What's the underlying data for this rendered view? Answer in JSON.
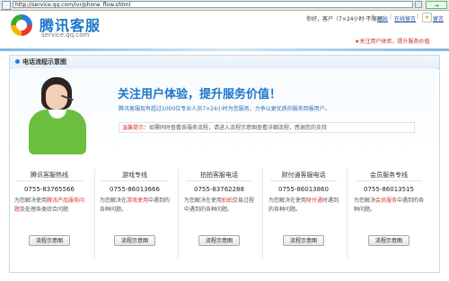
{
  "address_bar": {
    "url": "http://service.qq.com/ivr/phone_flow.shtml",
    "go_label": "→"
  },
  "header": {
    "logo_cn": "腾讯客服",
    "logo_en": "service.qq.com",
    "greeting": "你好，客户（7×24小时·不限时）",
    "links": [
      "退出",
      "在线留言",
      "留言"
    ],
    "slogan": "★关注用户体验，提升服务价值"
  },
  "panel": {
    "title": "电话流程示意图"
  },
  "banner": {
    "title": "关注用户体验，提升服务价值！",
    "subtitle": "腾讯客服现有超过1000位专业人员7×24小时为您服务，力争以更优质的服务回报用户。",
    "note_label": "温馨提示：",
    "note_text": "如需同时查看各服务流程，请进入流程示意图查看详细流程，感谢您的支持"
  },
  "columns": [
    {
      "title": "腾讯客服热线",
      "phone": "0755-83765566",
      "desc_pre": "为您解决使用",
      "desc_hl": "腾讯产品服务问题",
      "desc_post": "及处理各类综合问题",
      "button": "流程示意图"
    },
    {
      "title": "游戏专线",
      "phone": "0755-86013666",
      "desc_pre": "为您解决在",
      "desc_hl": "游戏使用",
      "desc_post": "中遇到的各种问题。",
      "button": "流程示意图"
    },
    {
      "title": "拍拍客服电话",
      "phone": "0755-83762288",
      "desc_pre": "为您解决在使用",
      "desc_hl": "拍拍",
      "desc_post": "交易过程中遇到的各种问题。",
      "button": "流程示意图"
    },
    {
      "title": "财付通客服电话",
      "phone": "0755-86013860",
      "desc_pre": "为您解决在使用",
      "desc_hl": "财付通",
      "desc_post": "时遇到的各种问题。",
      "button": "流程示意图"
    },
    {
      "title": "会员服务专线",
      "phone": "0755-86013515",
      "desc_pre": "为您解决",
      "desc_hl": "会员服务",
      "desc_post": "中遇到的各种问题。",
      "button": "流程示意图"
    }
  ]
}
